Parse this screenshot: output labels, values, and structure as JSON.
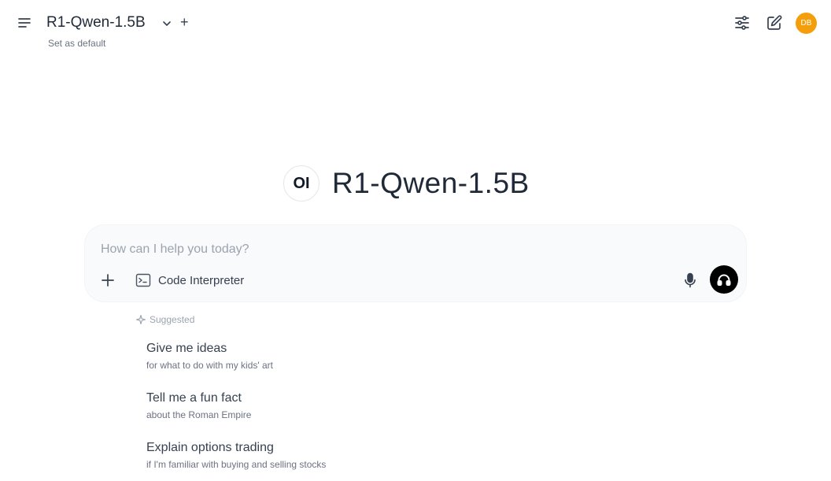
{
  "header": {
    "model_name": "R1-Qwen-1.5B",
    "add_model_label": "+",
    "set_default_label": "Set as default",
    "avatar_initials": "DB",
    "avatar_color": "#f59e0b",
    "icons": [
      "menu-icon",
      "chevron-down-icon",
      "sliders-icon",
      "edit-icon"
    ]
  },
  "hero": {
    "logo_text": "OI",
    "title": "R1-Qwen-1.5B"
  },
  "composer": {
    "placeholder": "How can I help you today?",
    "value": "",
    "code_interpreter_label": "Code Interpreter",
    "icons": [
      "plus-icon",
      "terminal-icon",
      "microphone-icon",
      "headphones-icon"
    ],
    "voice_button_color": "#000000"
  },
  "suggestions": {
    "header_label": "Suggested",
    "items": [
      {
        "title": "Give me ideas",
        "subtitle": "for what to do with my kids' art"
      },
      {
        "title": "Tell me a fun fact",
        "subtitle": "about the Roman Empire"
      },
      {
        "title": "Explain options trading",
        "subtitle": "if I'm familiar with buying and selling stocks"
      }
    ]
  }
}
